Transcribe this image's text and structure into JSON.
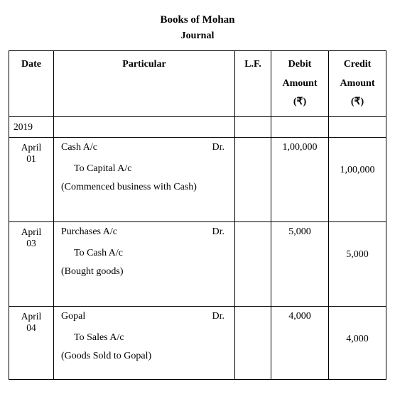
{
  "header": {
    "title": "Books of Mohan",
    "subtitle": "Journal"
  },
  "columns": {
    "date": "Date",
    "particular": "Particular",
    "lf": "L.F.",
    "debit_l1": "Debit",
    "debit_l2": "Amount",
    "debit_l3": "(₹)",
    "credit_l1": "Credit",
    "credit_l2": "Amount",
    "credit_l3": "(₹)"
  },
  "year": "2019",
  "entries": [
    {
      "date_l1": "April",
      "date_l2": "01",
      "dr_account": "Cash A/c",
      "dr_mark": "Dr.",
      "cr_account": "To Capital A/c",
      "narration": "(Commenced business with Cash)",
      "debit": "1,00,000",
      "credit": "1,00,000"
    },
    {
      "date_l1": "April",
      "date_l2": "03",
      "dr_account": "Purchases A/c",
      "dr_mark": "Dr.",
      "cr_account": "To Cash A/c",
      "narration": "(Bought goods)",
      "debit": "5,000",
      "credit": "5,000"
    },
    {
      "date_l1": "April",
      "date_l2": "04",
      "dr_account": "Gopal",
      "dr_mark": "Dr.",
      "cr_account": "To Sales A/c",
      "narration": "(Goods Sold to Gopal)",
      "debit": "4,000",
      "credit": "4,000"
    }
  ]
}
